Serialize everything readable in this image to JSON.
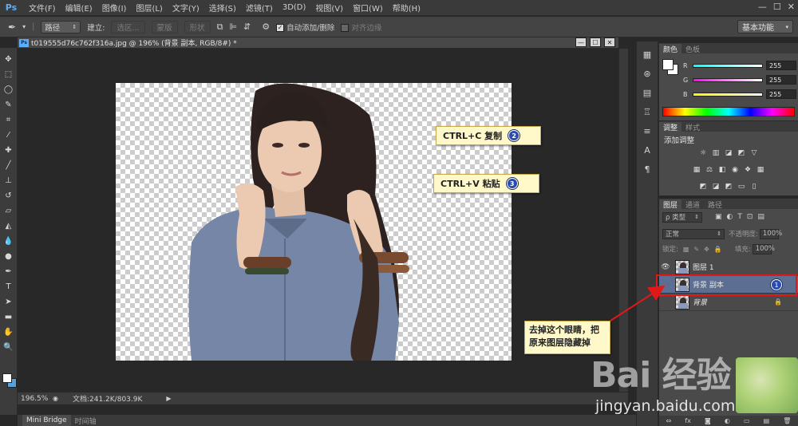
{
  "app": {
    "logo": "Ps",
    "menus": [
      "文件(F)",
      "编辑(E)",
      "图像(I)",
      "图层(L)",
      "文字(Y)",
      "选择(S)",
      "滤镜(T)",
      "3D(D)",
      "视图(V)",
      "窗口(W)",
      "帮助(H)"
    ],
    "window_controls": [
      "—",
      "☐",
      "✕"
    ]
  },
  "options": {
    "path_mode": "路径",
    "build_label": "建立:",
    "selection_btn": "选区...",
    "mask_btn": "蒙版",
    "shape_btn": "形状",
    "auto_add_delete": "自动添加/删除",
    "align_edges": "对齐边缘",
    "workspace": "基本功能"
  },
  "document": {
    "tab_title": "t019555d76c762f316a.jpg @ 196% (背景 副本, RGB/8#) *",
    "zoom": "196.5%",
    "doc_info": "文档:241.2K/803.9K"
  },
  "bottom_tabs": [
    "Mini Bridge",
    "时间轴"
  ],
  "color_panel": {
    "tabs": [
      "颜色",
      "色板"
    ],
    "channels": [
      {
        "label": "R",
        "value": "255",
        "gradient": "linear-gradient(to right,#00ffff,#ffffff)"
      },
      {
        "label": "G",
        "value": "255",
        "gradient": "linear-gradient(to right,#ff00ff,#ffffff)"
      },
      {
        "label": "B",
        "value": "255",
        "gradient": "linear-gradient(to right,#ffff00,#ffffff)"
      }
    ]
  },
  "adjust_panel": {
    "tabs": [
      "调整",
      "样式"
    ],
    "title": "添加调整"
  },
  "layers_panel": {
    "tabs": [
      "图层",
      "通道",
      "路径"
    ],
    "filter": "ρ 类型",
    "blend_mode": "正常",
    "opacity_label": "不透明度:",
    "opacity_value": "100%",
    "lock_label": "锁定:",
    "fill_label": "填充:",
    "fill_value": "100%",
    "layers": [
      {
        "name": "图层 1",
        "visible": true,
        "selected": false
      },
      {
        "name": "背景 副本",
        "visible": false,
        "selected": true
      },
      {
        "name": "背景",
        "visible": false,
        "selected": false,
        "locked": true
      }
    ],
    "footer": [
      "⇔",
      "fx",
      "◙",
      "◐",
      "▭",
      "▤",
      "🗑"
    ]
  },
  "callouts": {
    "copy": {
      "text": "CTRL+C  复制",
      "num": "2"
    },
    "paste": {
      "text": "CTRL+V  粘贴",
      "num": "3"
    },
    "layer_num": "1",
    "note": "去掉这个眼睛，把原来图层隐藏掉"
  },
  "watermark": {
    "logo": "Bai 经验",
    "url": "jingyan.baidu.com"
  },
  "colors": {
    "accent": "#5ab0ff",
    "highlight": "#e01818",
    "callout_bg": "#fff8c8",
    "selected_layer": "#5c6f93"
  }
}
